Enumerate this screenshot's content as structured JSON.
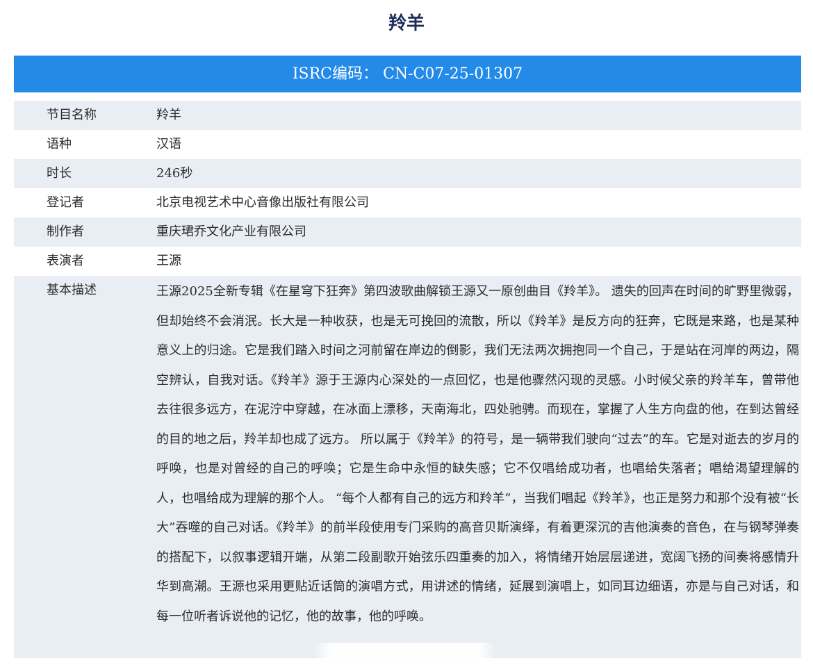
{
  "page": {
    "title": "羚羊"
  },
  "isrc": {
    "label": "ISRC编码：",
    "code": "CN-C07-25-01307"
  },
  "rows": [
    {
      "label": "节目名称",
      "value": "羚羊"
    },
    {
      "label": "语种",
      "value": "汉语"
    },
    {
      "label": "时长",
      "value": "246秒"
    },
    {
      "label": "登记者",
      "value": "北京电视艺术中心音像出版社有限公司"
    },
    {
      "label": "制作者",
      "value": "重庆珺乔文化产业有限公司"
    },
    {
      "label": "表演者",
      "value": "王源"
    }
  ],
  "description": {
    "label": "基本描述",
    "text": "王源2025全新专辑《在星穹下狂奔》第四波歌曲解锁王源又一原创曲目《羚羊》。 遗失的回声在时间的旷野里微弱，但却始终不会消泯。长大是一种收获，也是无可挽回的流散，所以《羚羊》是反方向的狂奔，它既是来路，也是某种意义上的归途。它是我们踏入时间之河前留在岸边的倒影，我们无法两次拥抱同一个自己，于是站在河岸的两边，隔空辨认，自我对话。《羚羊》源于王源内心深处的一点回忆，也是他骤然闪现的灵感。小时候父亲的羚羊车，曾带他去往很多远方，在泥泞中穿越，在冰面上漂移，天南海北，四处驰骋。而现在，掌握了人生方向盘的他，在到达曾经的目的地之后，羚羊却也成了远方。 所以属于《羚羊》的符号，是一辆带我们驶向“过去”的车。它是对逝去的岁月的呼唤，也是对曾经的自己的呼唤；它是生命中永恒的缺失感；它不仅唱给成功者，也唱给失落者；唱给渴望理解的人，也唱给成为理解的那个人。 “每个人都有自己的远方和羚羊”，当我们唱起《羚羊》，也正是努力和那个没有被“长大”吞噬的自己对话。《羚羊》的前半段使用专门采购的高音贝斯演绎，有着更深沉的吉他演奏的音色，在与钢琴弹奏的搭配下，以叙事逻辑开端，从第二段副歌开始弦乐四重奏的加入，将情绪开始层层递进，宽阔飞扬的间奏将感情升华到高潮。王源也采用更贴近话筒的演唱方式，用讲述的情绪，延展到演唱上，如同耳边细语，亦是与自己对话，和每一位听者诉说他的记忆，他的故事，他的呼唤。"
  }
}
